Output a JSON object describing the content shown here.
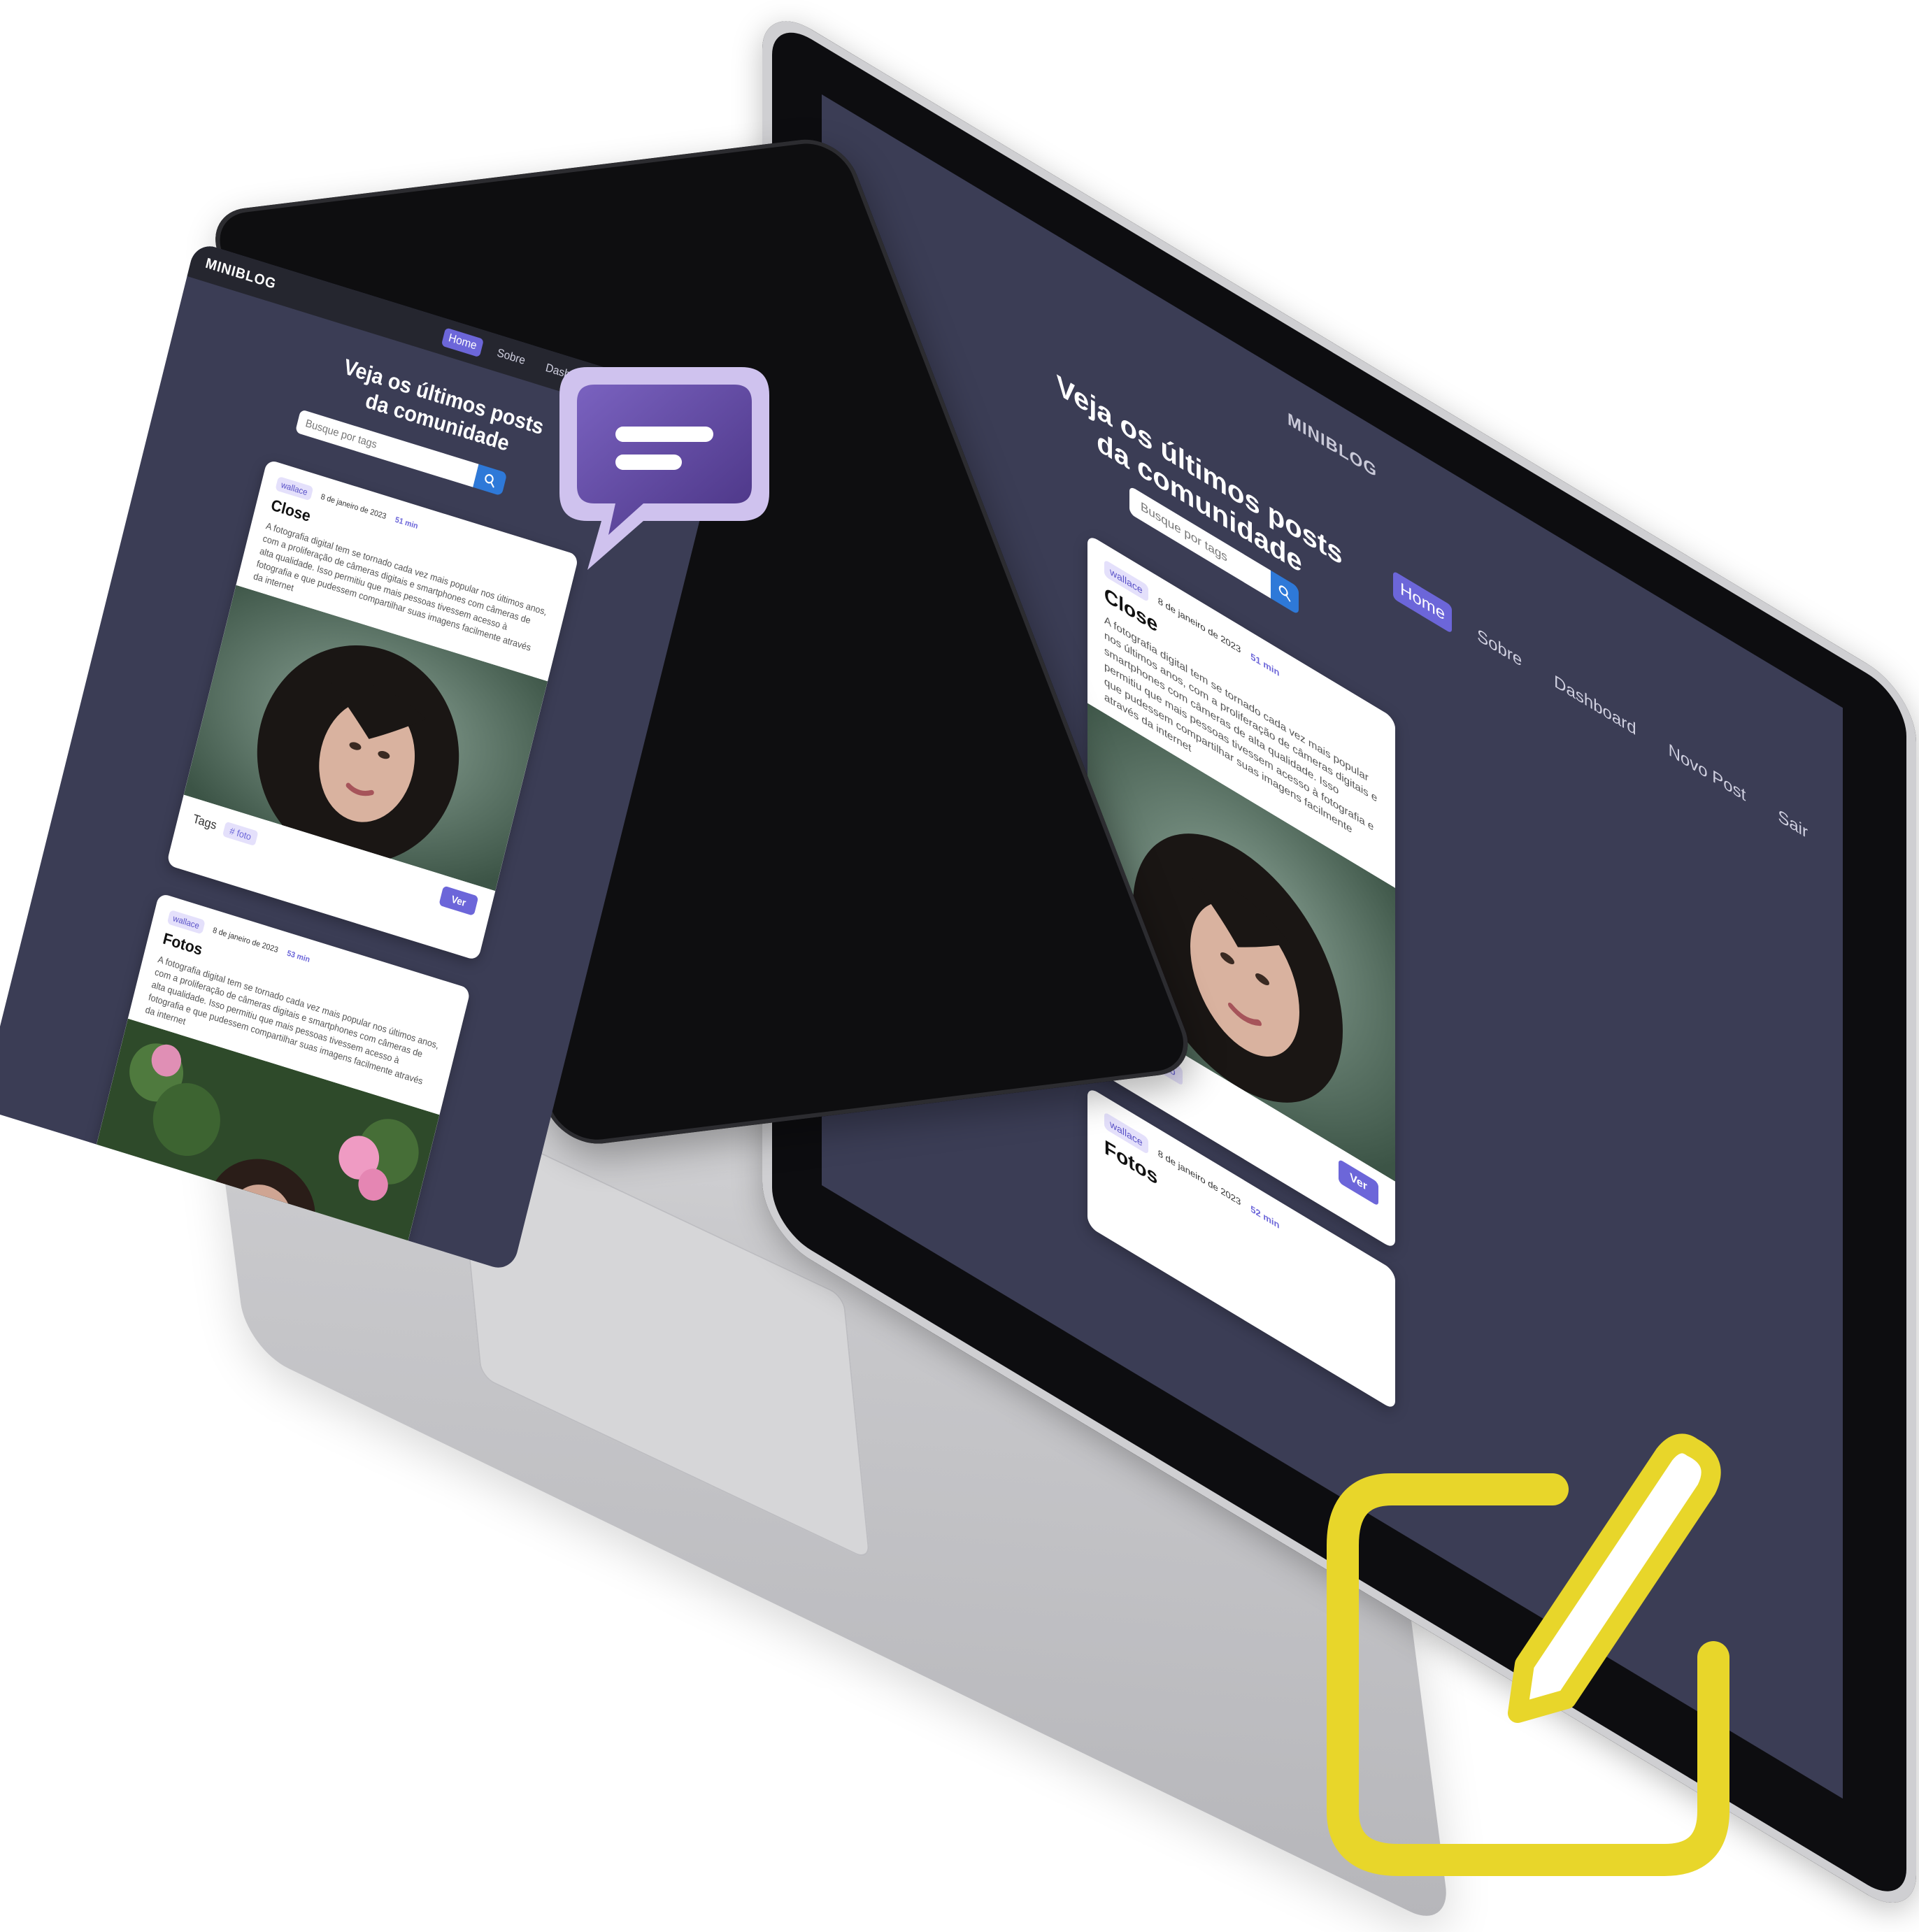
{
  "app": {
    "brand": "MINIBLOG",
    "nav": [
      {
        "label": "Home",
        "active": true
      },
      {
        "label": "Sobre",
        "active": false
      },
      {
        "label": "Dashboard",
        "active": false
      },
      {
        "label": "Novo Post",
        "active": false
      },
      {
        "label": "Sair",
        "active": false
      }
    ],
    "hero_line1": "Veja os últimos posts",
    "hero_line2": "da comunidade",
    "search_placeholder": "Busque por tags",
    "posts": [
      {
        "author": "wallace",
        "date": "8 de janeiro de 2023",
        "read_time": "51 min",
        "title": "Close",
        "body": "A fotografia digital tem se tornado cada vez mais popular nos últimos anos, com a proliferação de câmeras digitais e smartphones com câmeras de alta qualidade. Isso permitiu que mais pessoas tivessem acesso à fotografia e que pudessem compartilhar suas imagens facilmente através da internet",
        "tags_label": "Tags",
        "tag": "# foto",
        "button": "Ver"
      },
      {
        "author": "wallace",
        "date": "8 de janeiro de 2023",
        "read_time": "53 min",
        "title": "Fotos",
        "body": "A fotografia digital tem se tornado cada vez mais popular nos últimos anos, com a proliferação de câmeras digitais e smartphones com câmeras de alta qualidade. Isso permitiu que mais pessoas tivessem acesso à fotografia e que pudessem compartilhar suas imagens facilmente através da internet"
      }
    ],
    "laptop_second_read_time": "52 min"
  },
  "icons": {
    "search": "search-icon",
    "chat": "chat-bubble-icon",
    "edit": "edit-icon"
  },
  "colors": {
    "screen_bg": "#3b3d55",
    "accent": "#6c66d9",
    "search_button": "#2e79d8",
    "chat_purple": "#5b4594",
    "edit_yellow": "#e8d62a"
  }
}
